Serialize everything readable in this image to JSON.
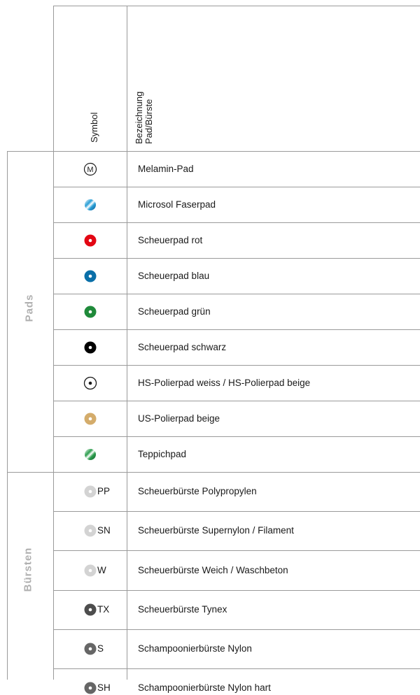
{
  "header": {
    "symbol_col": "Symbol",
    "name_col_line1": "Bezeichnung",
    "name_col_line2": "Pad/Bürste"
  },
  "groups": {
    "pads": "Pads",
    "brushes": "Bürsten"
  },
  "pads": [
    {
      "symbol": "melamin-icon",
      "symbol_text": "M",
      "label": "Melamin-Pad"
    },
    {
      "symbol": "microsol-icon",
      "label": "Microsol Faserpad",
      "color": "#2a9fd6"
    },
    {
      "symbol": "pad-red-icon",
      "label": "Scheuerpad rot",
      "color": "#e30613"
    },
    {
      "symbol": "pad-blue-icon",
      "label": "Scheuerpad blau",
      "color": "#0a6fa8"
    },
    {
      "symbol": "pad-green-icon",
      "label": "Scheuerpad grün",
      "color": "#1f8a3a"
    },
    {
      "symbol": "pad-black-icon",
      "label": "Scheuerpad schwarz",
      "color": "#000000"
    },
    {
      "symbol": "pad-white-icon",
      "label": "HS-Polierpad weiss / HS-Polierpad beige",
      "color": "#ffffff"
    },
    {
      "symbol": "pad-beige-icon",
      "label": "US-Polierpad beige",
      "color": "#d4ac6b"
    },
    {
      "symbol": "teppich-icon",
      "label": "Teppichpad",
      "color": "#2e9e4f"
    }
  ],
  "brushes": [
    {
      "symbol": "brush-light-icon",
      "code": "PP",
      "label": "Scheuerbürste Polypropylen",
      "color": "#d3d3d3"
    },
    {
      "symbol": "brush-light-icon",
      "code": "SN",
      "label": "Scheuerbürste Supernylon / Filament",
      "color": "#d3d3d3"
    },
    {
      "symbol": "brush-light-icon",
      "code": "W",
      "label": "Scheuerbürste Weich / Waschbeton",
      "color": "#d3d3d3"
    },
    {
      "symbol": "brush-dark-icon",
      "code": "TX",
      "label": "Scheuerbürste Tynex",
      "color": "#4d4d4d"
    },
    {
      "symbol": "brush-mid-icon",
      "code": "S",
      "label": "Schampoonierbürste Nylon",
      "color": "#666666"
    },
    {
      "symbol": "brush-mid-icon",
      "code": "SH",
      "label": "Schampoonierbürste Nylon hart",
      "color": "#666666"
    }
  ]
}
